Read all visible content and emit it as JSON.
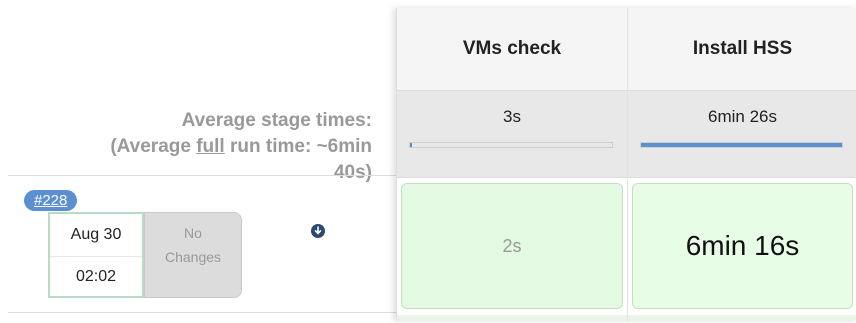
{
  "summary": {
    "avg_line1": "Average stage times:",
    "avg_line2_prefix": "(Average ",
    "avg_line2_full": "full",
    "avg_line2_suffix": " run time: ~6min",
    "avg_line3": "40s)"
  },
  "build": {
    "number": "#228",
    "date": "Aug 30",
    "time": "02:02",
    "changes_line1": "No",
    "changes_line2": "Changes"
  },
  "stages": [
    {
      "name": "VMs check",
      "avg_time": "3s",
      "avg_fraction": 0.008,
      "cell_time": "2s"
    },
    {
      "name": "Install HSS",
      "avg_time": "6min 26s",
      "avg_fraction": 1.0,
      "cell_time": "6min 16s"
    }
  ],
  "colors": {
    "badge": "#5a8fd0",
    "success_cell": "#e4f9e2",
    "bar": "#5a8fd0"
  }
}
